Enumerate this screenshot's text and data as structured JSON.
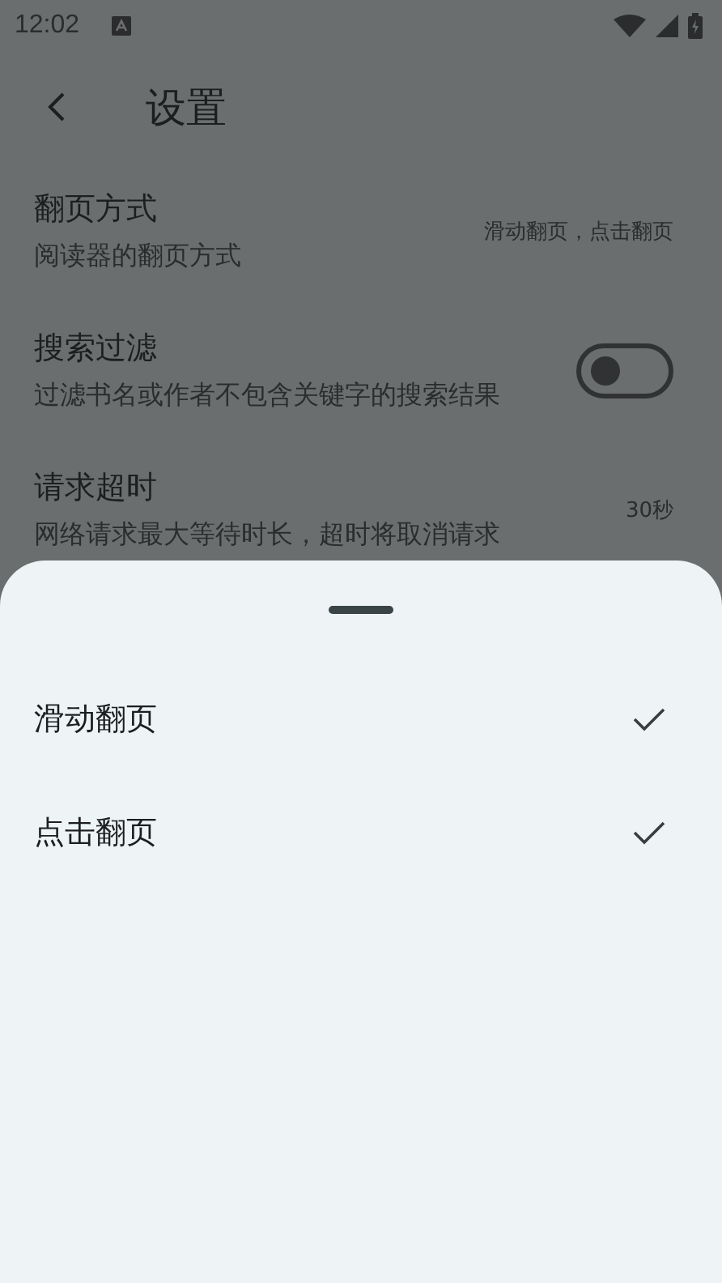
{
  "status_bar": {
    "time": "12:02"
  },
  "toolbar": {
    "title": "设置"
  },
  "settings": [
    {
      "kind": "value",
      "title": "翻页方式",
      "subtitle": "阅读器的翻页方式",
      "value": "滑动翻页，点击翻页"
    },
    {
      "kind": "switch",
      "title": "搜索过滤",
      "subtitle": "过滤书名或作者不包含关键字的搜索结果",
      "on": false
    },
    {
      "kind": "value",
      "title": "请求超时",
      "subtitle": "网络请求最大等待时长，超时将取消请求",
      "value": "30秒"
    }
  ],
  "sheet": {
    "options": [
      {
        "label": "滑动翻页",
        "checked": true
      },
      {
        "label": "点击翻页",
        "checked": true
      }
    ]
  }
}
